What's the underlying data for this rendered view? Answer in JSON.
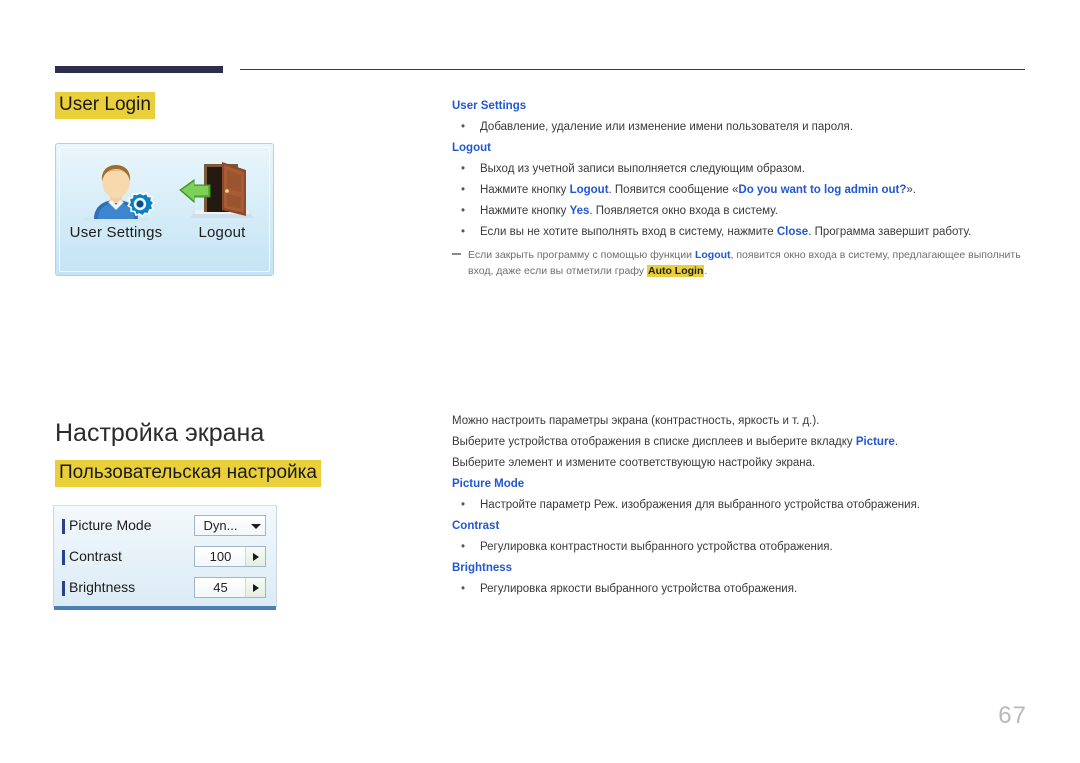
{
  "page": {
    "number": "67"
  },
  "section_user_login": {
    "heading": "User Login",
    "figure": {
      "items": [
        {
          "icon": "user-settings-icon",
          "label": "User Settings"
        },
        {
          "icon": "logout-door-icon",
          "label": "Logout"
        }
      ]
    },
    "blocks": [
      {
        "subhead": "User Settings",
        "bullets": [
          "Добавление, удаление или изменение имени пользователя и пароля."
        ]
      },
      {
        "subhead": "Logout",
        "bullets": [
          "Выход из учетной записи выполняется следующим образом."
        ]
      }
    ],
    "steps": [
      {
        "pre": "Нажмите кнопку ",
        "em1": "Logout",
        "mid": ". Появится сообщение «",
        "em2": "Do you want to log admin out?",
        "post": "»."
      },
      {
        "pre": "Нажмите кнопку ",
        "em1": "Yes",
        "mid": ". Появляется окно входа в систему.",
        "em2": "",
        "post": ""
      },
      {
        "pre": "Если вы не хотите выполнять вход в систему, нажмите ",
        "em1": "Close",
        "mid": ". Программа завершит работу.",
        "em2": "",
        "post": ""
      }
    ],
    "note": {
      "pre": "Если закрыть программу с помощью функции ",
      "em1": "Logout",
      "mid": ", появится окно входа в систему, предлагающее выполнить вход, даже если вы отметили графу ",
      "em2": "Auto Login",
      "post": "."
    }
  },
  "section_screen_settings": {
    "heading": "Настройка экрана",
    "subheading": "Пользовательская настройка",
    "figure": {
      "rows": [
        {
          "label": "Picture Mode",
          "value": "Dyn...",
          "control": "dropdown"
        },
        {
          "label": "Contrast",
          "value": "100",
          "control": "stepper"
        },
        {
          "label": "Brightness",
          "value": "45",
          "control": "stepper"
        }
      ]
    },
    "intro_lines": [
      {
        "pre": "Можно настроить параметры экрана (контрастность, яркость и т. д.).",
        "em1": "",
        "post": ""
      },
      {
        "pre": "Выберите устройства отображения в списке дисплеев и выберите вкладку ",
        "em1": "Picture",
        "post": "."
      },
      {
        "pre": "Выберите элемент и измените соответствующую настройку экрана.",
        "em1": "",
        "post": ""
      }
    ],
    "blocks": [
      {
        "subhead": "Picture Mode",
        "bullets": [
          "Настройте параметр Реж. изображения для выбранного устройства отображения."
        ]
      },
      {
        "subhead": "Contrast",
        "bullets": [
          "Регулировка контрастности выбранного устройства отображения."
        ]
      },
      {
        "subhead": "Brightness",
        "bullets": [
          "Регулировка яркости выбранного устройства отображения."
        ]
      }
    ]
  },
  "colors": {
    "highlight": "#e9cf3a",
    "accent_blue": "#2257d4",
    "rule_dark": "#2e2d4e",
    "page_number": "#b9b9b9"
  },
  "bullet_glyph": "•"
}
